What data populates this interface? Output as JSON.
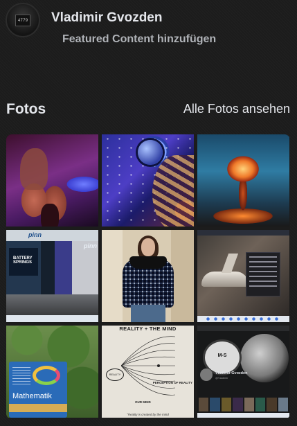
{
  "profile": {
    "avatar_text": "4779",
    "name": "Vladimir Gvozden",
    "featured_link": "Featured Content hinzufügen"
  },
  "photos_section": {
    "title": "Fotos",
    "see_all": "Alle Fotos ansehen"
  },
  "tiles": {
    "fair_sign": "BATTERY SPRINGS",
    "fair_brand": "pinn",
    "fair_brand_2": "pinn",
    "book_title": "Mathematik",
    "reality_header": "REALITY + THE MIND",
    "reality_circle": "REALITY",
    "reality_perception": "PERCEPTION OF REALITY",
    "reality_mind": "OUR MIND",
    "reality_footer": "\"Reality is created by the mind",
    "profile_logo": "M-S",
    "profile_name": "Vladimir Gvozden",
    "profile_sub": "@Vladimir"
  },
  "colors": {
    "background": "#1c1c1c",
    "primary_text": "#e4e6eb",
    "secondary_text": "#b0b3b8"
  }
}
